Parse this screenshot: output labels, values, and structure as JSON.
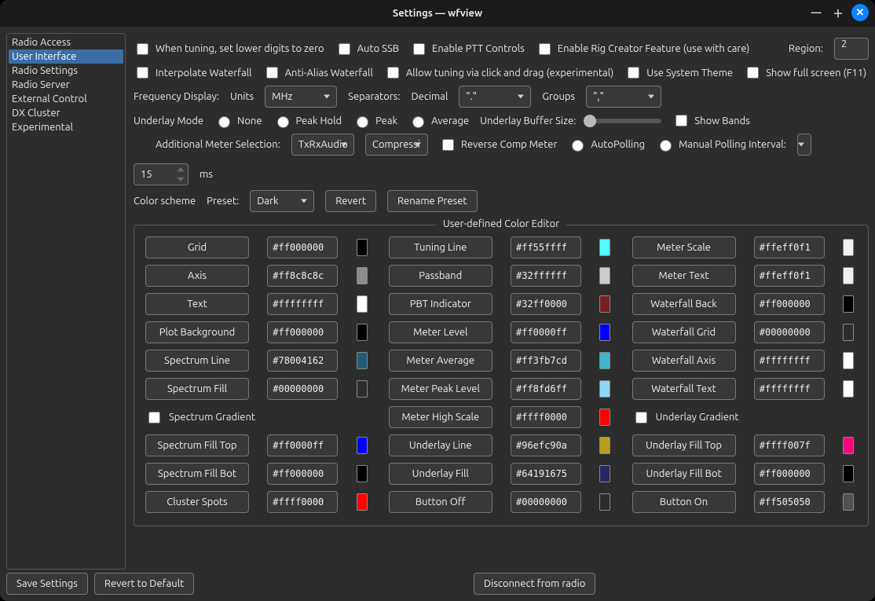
{
  "window": {
    "title": "Settings — wfview"
  },
  "sidebar": {
    "items": [
      {
        "label": "Radio Access"
      },
      {
        "label": "User Interface",
        "selected": true
      },
      {
        "label": "Radio Settings"
      },
      {
        "label": "Radio Server"
      },
      {
        "label": "External Control"
      },
      {
        "label": "DX Cluster"
      },
      {
        "label": "Experimental"
      }
    ]
  },
  "row1": {
    "tune_lower_zero": "When tuning, set lower digits to zero",
    "auto_ssb": "Auto SSB",
    "enable_ptt": "Enable PTT Controls",
    "rig_creator": "Enable Rig Creator Feature (use with care)",
    "region_label": "Region:",
    "region_value": "2"
  },
  "row2": {
    "interp_wf": "Interpolate Waterfall",
    "antialias_wf": "Anti-Alias Waterfall",
    "click_drag": "Allow tuning via click and drag (experimental)",
    "system_theme": "Use System Theme",
    "fullscreen": "Show full screen (F11)"
  },
  "row3": {
    "freq_disp": "Frequency Display:",
    "units": "Units",
    "units_value": "MHz",
    "separators": "Separators:",
    "decimal": "Decimal",
    "decimal_value": "\".\"",
    "groups": "Groups",
    "groups_value": "\",\""
  },
  "row4": {
    "underlay_mode": "Underlay Mode",
    "none": "None",
    "peak_hold": "Peak Hold",
    "peak": "Peak",
    "average": "Average",
    "buffer_size": "Underlay Buffer Size:",
    "show_bands": "Show Bands"
  },
  "row5": {
    "add_meter": "Additional Meter Selection:",
    "meter1": "TxRxAudio",
    "meter2": "Compressi",
    "reverse_comp": "Reverse Comp Meter",
    "autopoll": "AutoPolling",
    "manual_poll": "Manual Polling Interval:",
    "poll_value": "15",
    "ms": "ms"
  },
  "row6": {
    "color_scheme": "Color scheme",
    "preset": "Preset:",
    "preset_value": "Dark",
    "revert": "Revert",
    "rename": "Rename Preset"
  },
  "groupbox": {
    "legend": "User-defined Color Editor"
  },
  "checks": {
    "spectrum_gradient": "Spectrum Gradient",
    "underlay_gradient": "Underlay Gradient"
  },
  "colors": {
    "c0": {
      "label": "Grid",
      "value": "#ff000000",
      "sw": "#000000"
    },
    "c1": {
      "label": "Tuning Line",
      "value": "#ff55ffff",
      "sw": "#55ffff"
    },
    "c2": {
      "label": "Meter Scale",
      "value": "#ffeff0f1",
      "sw": "#eff0f1"
    },
    "c3": {
      "label": "Axis",
      "value": "#ff8c8c8c",
      "sw": "#8c8c8c"
    },
    "c4": {
      "label": "Passband",
      "value": "#32ffffff",
      "sw": "#cccccc"
    },
    "c5": {
      "label": "Meter Text",
      "value": "#ffeff0f1",
      "sw": "#eff0f1"
    },
    "c6": {
      "label": "Text",
      "value": "#ffffffff",
      "sw": "#ffffff"
    },
    "c7": {
      "label": "PBT Indicator",
      "value": "#32ff0000",
      "sw": "#7a1f1f"
    },
    "c8": {
      "label": "Waterfall Back",
      "value": "#ff000000",
      "sw": "#000000"
    },
    "c9": {
      "label": "Plot Background",
      "value": "#ff000000",
      "sw": "#000000"
    },
    "c10": {
      "label": "Meter Level",
      "value": "#ff0000ff",
      "sw": "#0000ff"
    },
    "c11": {
      "label": "Waterfall Grid",
      "value": "#00000000",
      "sw": "#2d2d2d"
    },
    "c12": {
      "label": "Spectrum Line",
      "value": "#78004162",
      "sw": "#1f5d78"
    },
    "c13": {
      "label": "Meter Average",
      "value": "#ff3fb7cd",
      "sw": "#3fb7cd"
    },
    "c14": {
      "label": "Waterfall Axis",
      "value": "#ffffffff",
      "sw": "#ffffff"
    },
    "c15": {
      "label": "Spectrum Fill",
      "value": "#00000000",
      "sw": "#2d2d2d"
    },
    "c16": {
      "label": "Meter Peak Level",
      "value": "#ff8fd6ff",
      "sw": "#8fd6ff"
    },
    "c17": {
      "label": "Waterfall Text",
      "value": "#ffffffff",
      "sw": "#ffffff"
    },
    "c18": {
      "label": "Meter High Scale",
      "value": "#ffff0000",
      "sw": "#ff0000"
    },
    "c19": {
      "label": "Spectrum Fill Top",
      "value": "#ff0000ff",
      "sw": "#0000ff"
    },
    "c20": {
      "label": "Underlay Line",
      "value": "#96efc90a",
      "sw": "#b89f20"
    },
    "c21": {
      "label": "Underlay Fill Top",
      "value": "#ffff007f",
      "sw": "#ff007f"
    },
    "c22": {
      "label": "Spectrum Fill Bot",
      "value": "#ff000000",
      "sw": "#000000"
    },
    "c23": {
      "label": "Underlay Fill",
      "value": "#64191675",
      "sw": "#2a2760"
    },
    "c24": {
      "label": "Underlay Fill Bot",
      "value": "#ff000000",
      "sw": "#000000"
    },
    "c25": {
      "label": "Cluster Spots",
      "value": "#ffff0000",
      "sw": "#ff0000"
    },
    "c26": {
      "label": "Button Off",
      "value": "#00000000",
      "sw": "#2d2d2d"
    },
    "c27": {
      "label": "Button On",
      "value": "#ff505050",
      "sw": "#505050"
    }
  },
  "footer": {
    "save": "Save Settings",
    "revert_default": "Revert to Default",
    "disconnect": "Disconnect from radio"
  }
}
